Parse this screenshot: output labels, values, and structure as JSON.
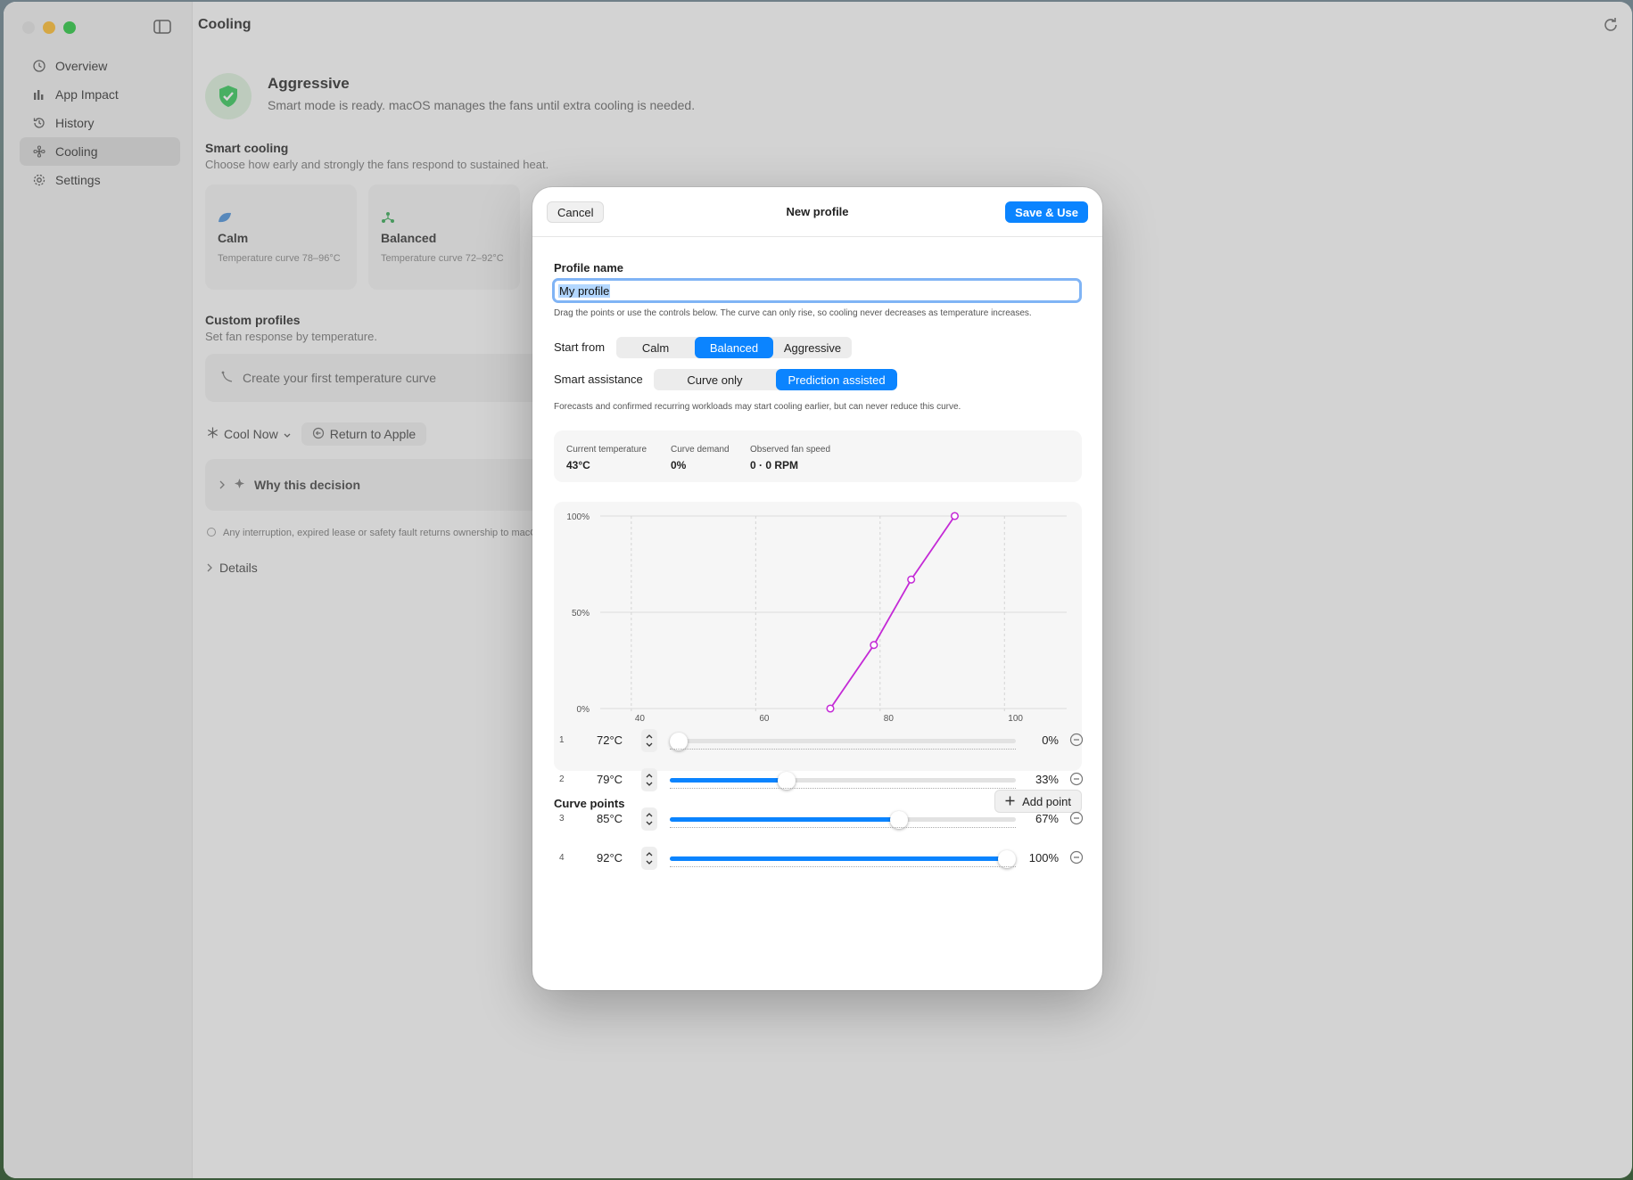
{
  "window": {
    "title": "Cooling"
  },
  "sidebar": {
    "items": [
      {
        "label": "Overview",
        "icon": "clock-icon"
      },
      {
        "label": "App Impact",
        "icon": "bar-chart-icon"
      },
      {
        "label": "History",
        "icon": "history-icon"
      },
      {
        "label": "Cooling",
        "icon": "fan-icon",
        "active": true
      },
      {
        "label": "Settings",
        "icon": "gear-icon"
      }
    ]
  },
  "main": {
    "status_title": "Aggressive",
    "status_text": "Smart mode is ready. macOS manages the fans until extra cooling is needed.",
    "smart_cooling": {
      "title": "Smart cooling",
      "subtitle": "Choose how early and strongly the fans respond to sustained heat.",
      "modes": [
        {
          "name": "Calm",
          "range": "Temperature curve 78–96°C",
          "icon": "leaf-icon"
        },
        {
          "name": "Balanced",
          "range": "Temperature curve 72–92°C",
          "icon": "balance-icon"
        }
      ]
    },
    "custom_profiles": {
      "title": "Custom profiles",
      "subtitle": "Set fan response by temperature.",
      "empty_cta": "Create your first temperature curve"
    },
    "cool_now": "Cool Now",
    "return_to_apple": "Return to Apple",
    "why_decision": "Why this decision",
    "disclaimer": "Any interruption, expired lease or safety fault returns ownership to macO",
    "details": "Details"
  },
  "dialog": {
    "title": "New profile",
    "cancel": "Cancel",
    "save": "Save & Use",
    "profile_name_label": "Profile name",
    "profile_name_value": "My profile",
    "hint": "Drag the points or use the controls below. The curve can only rise, so cooling never decreases as temperature increases.",
    "start_from": {
      "label": "Start from",
      "options": [
        "Calm",
        "Balanced",
        "Aggressive"
      ],
      "selected": "Balanced"
    },
    "smart_assistance": {
      "label": "Smart assistance",
      "options": [
        "Curve only",
        "Prediction assisted"
      ],
      "selected": "Prediction assisted"
    },
    "assist_note": "Forecasts and confirmed recurring workloads may start cooling earlier, but can never reduce this curve.",
    "stats": [
      {
        "label": "Current temperature",
        "value": "43°C"
      },
      {
        "label": "Curve demand",
        "value": "0%"
      },
      {
        "label": "Observed fan speed",
        "value": "0 · 0 RPM"
      }
    ],
    "curve_points_title": "Curve points",
    "add_point": "Add point",
    "points": [
      {
        "index": "1",
        "temp": "72°C",
        "pct": "0%",
        "value": 0
      },
      {
        "index": "2",
        "temp": "79°C",
        "pct": "33%",
        "value": 33
      },
      {
        "index": "3",
        "temp": "85°C",
        "pct": "67%",
        "value": 67
      },
      {
        "index": "4",
        "temp": "92°C",
        "pct": "100%",
        "value": 100
      }
    ]
  },
  "chart_data": {
    "type": "line",
    "x": [
      72,
      79,
      85,
      92
    ],
    "y": [
      0,
      33,
      67,
      100
    ],
    "xlim": [
      35,
      110
    ],
    "ylim": [
      0,
      100
    ],
    "x_ticks": [
      "40",
      "60",
      "80",
      "100"
    ],
    "y_ticks": [
      "0%",
      "50%",
      "100%"
    ],
    "line_color": "#c42ad6",
    "grid": true
  },
  "colors": {
    "accent": "#0b84ff",
    "curve": "#c42ad6",
    "shield": "#34c759"
  }
}
